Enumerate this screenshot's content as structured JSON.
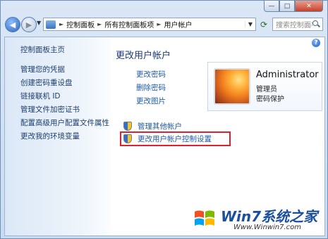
{
  "window": {
    "min_glyph": "—",
    "max_glyph": "□",
    "close_glyph": "✕"
  },
  "breadcrumb": {
    "items": [
      "控制面板",
      "所有控制面板项",
      "用户帐户"
    ],
    "separator": "►"
  },
  "search": {
    "placeholder": "搜索控制面板"
  },
  "left_pane": {
    "home": "控制面板主页",
    "links": [
      "管理您的凭据",
      "创建密码重设盘",
      "链接联机 ID",
      "管理文件加密证书",
      "配置高级用户配置文件属性",
      "更改我的环境变量"
    ]
  },
  "main": {
    "title": "更改用户帐户",
    "links": [
      "更改密码",
      "删除密码",
      "更改图片"
    ],
    "shield_links": [
      "管理其他帐户",
      "更改用户帐户控制设置"
    ]
  },
  "user": {
    "name": "Administrator",
    "role": "管理员",
    "password_status": "密码保护"
  },
  "watermark": {
    "title": "Win7系统之家",
    "url": "Www.Winwin7.com"
  }
}
